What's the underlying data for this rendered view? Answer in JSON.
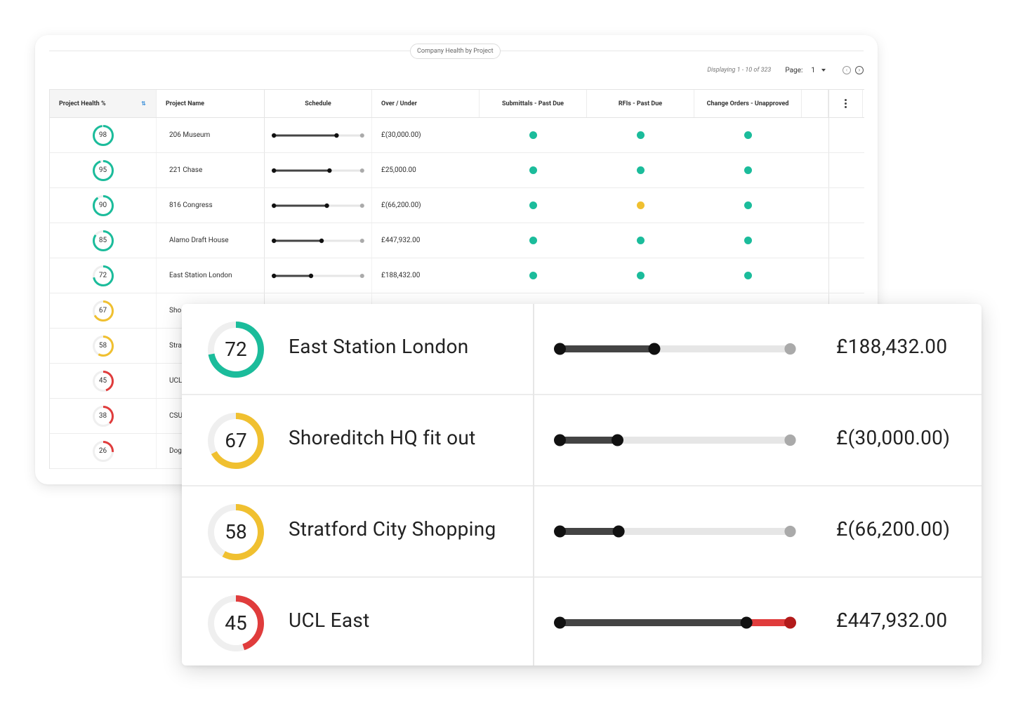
{
  "panel": {
    "title": "Company Health by Project",
    "displaying": "Displaying 1 - 10 of 323",
    "page_label": "Page:",
    "page_value": "1"
  },
  "columns": [
    "Project Health %",
    "Project Name",
    "Schedule",
    "Over / Under",
    "Submittals - Past Due",
    "RFIs - Past Due",
    "Change Orders - Unapproved"
  ],
  "colors": {
    "good": "#1bbc9b",
    "warn": "#f0c030",
    "bad": "#e03c3c",
    "ring_track": "#efefef",
    "bar_fill": "#444444",
    "bar_track": "#e6e6e6",
    "bar_end": "#aaaaaa"
  },
  "rows": [
    {
      "health": 98,
      "name": "206 Museum",
      "schedule": 0.71,
      "over_under": "£(30,000.00)",
      "submittals": "good",
      "rfis": "good",
      "change_orders": "good"
    },
    {
      "health": 95,
      "name": "221 Chase",
      "schedule": 0.63,
      "over_under": "£25,000.00",
      "submittals": "good",
      "rfis": "good",
      "change_orders": "good"
    },
    {
      "health": 90,
      "name": "816 Congress",
      "schedule": 0.6,
      "over_under": "£(66,200.00)",
      "submittals": "good",
      "rfis": "warn",
      "change_orders": "good"
    },
    {
      "health": 85,
      "name": "Alamo Draft House",
      "schedule": 0.54,
      "over_under": "£447,932.00",
      "submittals": "good",
      "rfis": "good",
      "change_orders": "good"
    },
    {
      "health": 72,
      "name": "East Station London",
      "schedule": 0.42,
      "over_under": "£188,432.00",
      "submittals": "good",
      "rfis": "good",
      "change_orders": "good"
    },
    {
      "health": 67,
      "name": "Sho"
    },
    {
      "health": 58,
      "name": "Stra"
    },
    {
      "health": 45,
      "name": "UCL"
    },
    {
      "health": 38,
      "name": "CSU"
    },
    {
      "health": 26,
      "name": "Dog"
    }
  ],
  "zoom_rows": [
    {
      "health": 72,
      "status": "good",
      "name": "East Station London",
      "schedule": 0.41,
      "overrun": 0,
      "amount": "£188,432.00"
    },
    {
      "health": 67,
      "status": "warn",
      "name": "Shoreditch HQ fit out",
      "schedule": 0.25,
      "overrun": 0,
      "amount": "£(30,000.00)"
    },
    {
      "health": 58,
      "status": "warn",
      "name": "Stratford City Shopping",
      "schedule": 0.255,
      "overrun": 0,
      "amount": "£(66,200.00)"
    },
    {
      "health": 45,
      "status": "bad",
      "name": "UCL East",
      "schedule": 0.81,
      "overrun": 0.19,
      "amount": "£447,932.00"
    }
  ]
}
